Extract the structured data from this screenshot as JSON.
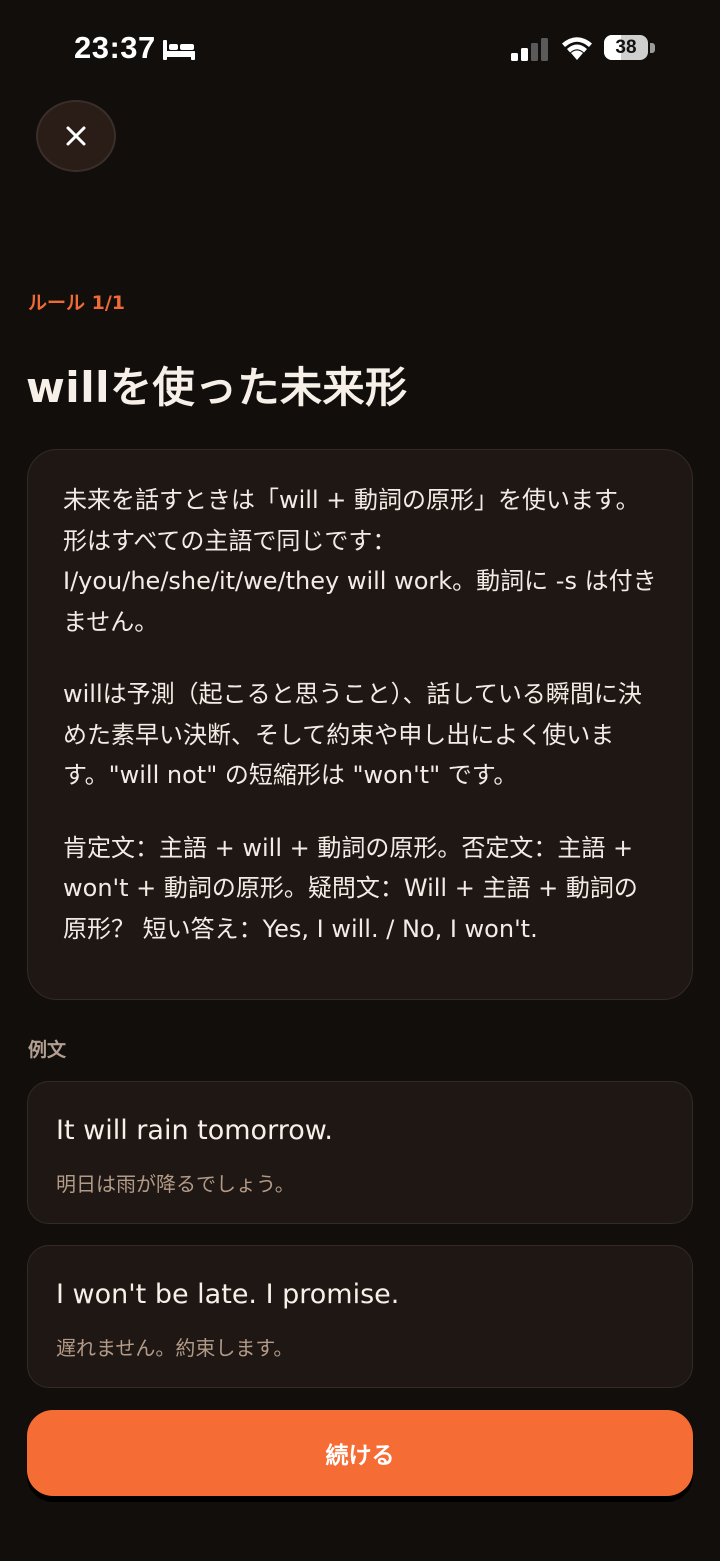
{
  "status_bar": {
    "time": "23:37",
    "battery_level": "38",
    "battery_fraction": 0.38
  },
  "header": {
    "close_icon": "close-icon",
    "rule_counter": "ルール 1/1",
    "title": "willを使った未来形"
  },
  "explanation": {
    "paragraphs": [
      "未来を話すときは「will + 動詞の原形」を使います。形はすべての主語で同じです：I/you/he/she/it/we/they will work。動詞に -s は付きません。",
      "willは予測（起こると思うこと）、話している瞬間に決めた素早い決断、そして約束や申し出によく使います。\"will not\" の短縮形は \"won't\" です。",
      "肯定文：主語 + will + 動詞の原形。否定文：主語 + won't + 動詞の原形。疑問文：Will + 主語 + 動詞の原形？ 短い答え：Yes, I will. / No, I won't."
    ]
  },
  "examples": {
    "label": "例文",
    "items": [
      {
        "en": "It will rain tomorrow.",
        "ja": "明日は雨が降るでしょう。"
      },
      {
        "en": "I won't be late. I promise.",
        "ja": "遅れません。約束します。"
      }
    ]
  },
  "footer": {
    "continue_label": "続ける"
  },
  "colors": {
    "background": "#120e0c",
    "card": "#1f1713",
    "accent": "#f56d35",
    "rule_counter": "#ef6a34"
  }
}
